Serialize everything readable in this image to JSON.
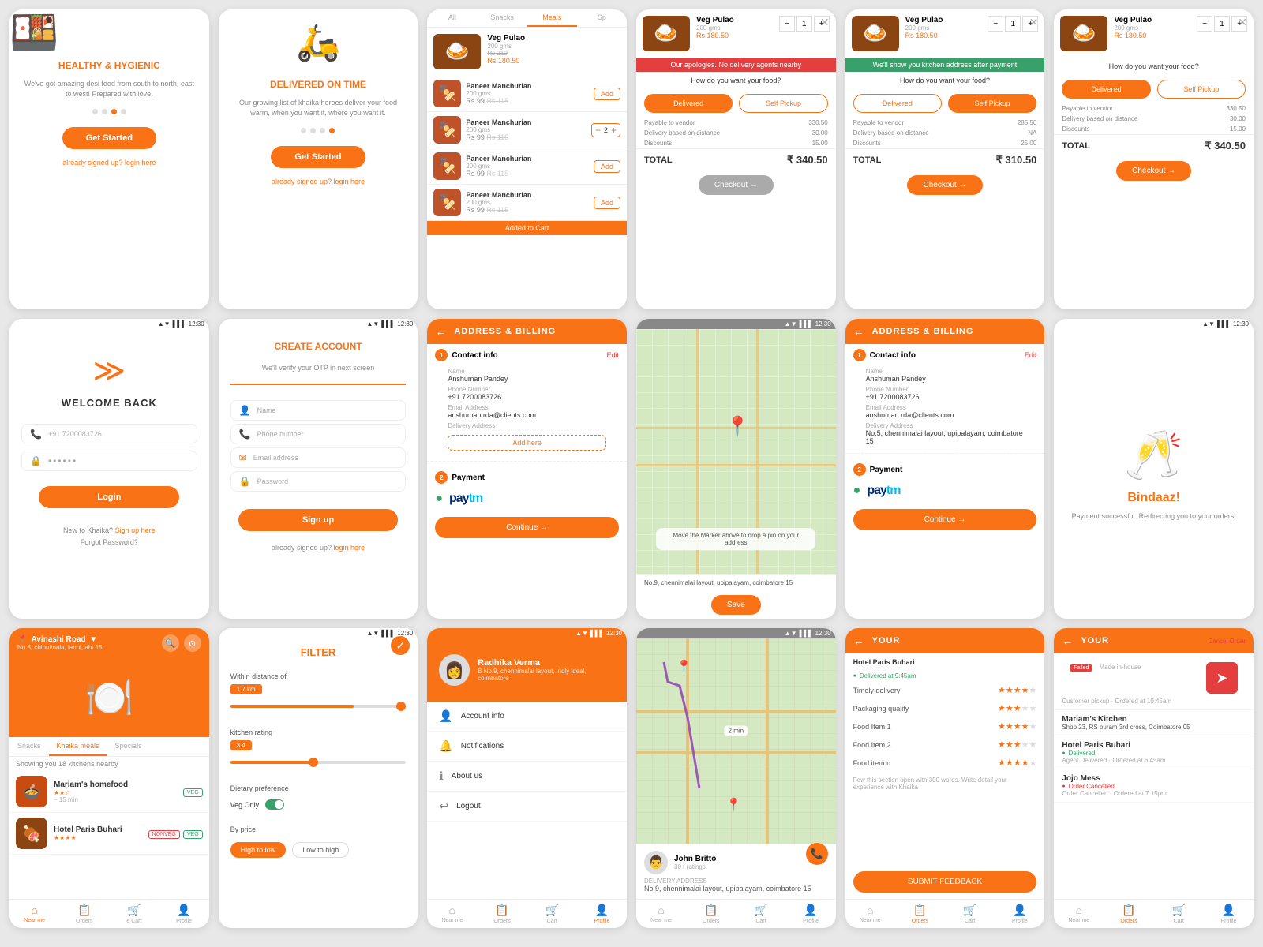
{
  "row1": {
    "card1": {
      "title": "HEALTHY & HYGIENIC",
      "desc": "We've got amazing desi food from south to north, east to west! Prepared with love.",
      "cta": "Get Started",
      "footer": "already signed up?",
      "login": "login here",
      "dots": [
        false,
        false,
        true,
        false
      ]
    },
    "card2": {
      "title": "DELIVERED ON TIME",
      "desc": "Our growing list of khaika heroes deliver your food warm, when you want it, where you want it.",
      "cta": "Get Started",
      "footer": "already signed up?",
      "login": "login here",
      "dots": [
        false,
        false,
        false,
        true
      ]
    },
    "card3": {
      "tabs": [
        "All",
        "Snacks",
        "Meals",
        "Sp"
      ],
      "active_tab": 2,
      "food_name": "Veg Pulao",
      "food_qty": "200 gms",
      "food_price_old": "Rs 210",
      "food_price_new": "Rs 180.50",
      "items": [
        {
          "name": "Paneer Manchurian",
          "qty": "200 gms",
          "price_old": "Rs 115",
          "price_new": "Rs 99",
          "action": "add"
        },
        {
          "name": "Paneer Manchurian",
          "qty": "200 gms",
          "price_old": "Rs 115",
          "price_new": "Rs 99",
          "action": "qty",
          "qty_val": "2"
        },
        {
          "name": "Paneer Manchurian",
          "qty": "200 gms",
          "price_old": "Rs 115",
          "price_new": "Rs 99",
          "action": "add"
        },
        {
          "name": "Paneer Manchurian",
          "qty": "200 gms",
          "price_old": "Rs 115",
          "price_new": "Rs 99",
          "action": "add"
        }
      ],
      "added_banner": "Added to Cart"
    },
    "card4": {
      "food_name": "Veg Pulao",
      "food_qty": "200 gms",
      "food_price_new": "Rs 180.50",
      "sorry_banner": "Our apologies. No delivery agents nearby",
      "how_food": "How do you want your food?",
      "delivered": "Delivered",
      "self_pickup": "Self Pickup",
      "details": [
        {
          "label": "Payable to vendor",
          "val": "330.50"
        },
        {
          "label": "Delivery based on distance",
          "val": "30.00"
        },
        {
          "label": "Discounts",
          "val": "15.00"
        }
      ],
      "total_label": "TOTAL",
      "total_amount": "₹ 340.50",
      "checkout": "Checkout →"
    },
    "card5": {
      "food_name": "Veg Pulao",
      "food_qty": "200 gms",
      "food_price_new": "Rs 180.50",
      "success_banner": "We'll show you kitchen address after payment",
      "how_food": "How do you want your food?",
      "delivered": "Delivered",
      "self_pickup": "Self Pickup",
      "details": [
        {
          "label": "Payable to vendor",
          "val": "285.50"
        },
        {
          "label": "Delivery based on distance",
          "val": "NA"
        },
        {
          "label": "Discounts",
          "val": "25.00"
        }
      ],
      "total_label": "TOTAL",
      "total_amount": "₹ 310.50",
      "checkout": "Checkout →"
    },
    "card6": {
      "food_name": "Veg Pulao",
      "food_qty": "200 gms",
      "food_price_new": "Rs 180.50",
      "how_food": "How do you want your food?",
      "delivered": "Delivered",
      "self_pickup": "Self Pickup",
      "details": [
        {
          "label": "Payable to vendor",
          "val": "330.50"
        },
        {
          "label": "Delivery based on distance",
          "val": "30.00"
        },
        {
          "label": "Discounts",
          "val": "15.00"
        }
      ],
      "total_label": "TOTAL",
      "total_amount": "₹ 340.50",
      "checkout": "Checkout →"
    }
  },
  "row2": {
    "card1": {
      "logo": "≫",
      "title": "WELCOME BACK",
      "phone_placeholder": "+91 7200083726",
      "password_placeholder": "••••••",
      "login_btn": "Login",
      "new_user": "New to Khaika?",
      "signup_link": "Sign up here",
      "forgot": "Forgot Password?"
    },
    "card2": {
      "title": "CREATE ACCOUNT",
      "subtitle": "We'll verify your OTP in next screen",
      "name_placeholder": "Name",
      "phone_placeholder": "Phone number",
      "email_placeholder": "Email address",
      "password_placeholder": "Password",
      "signup_btn": "Sign up",
      "already": "already signed up?",
      "login_link": "login here"
    },
    "card3": {
      "header": "ADDRESS & BILLING",
      "step1": "1",
      "contact_title": "Contact info",
      "edit": "Edit",
      "name_label": "Name",
      "name_val": "Anshuman Pandey",
      "phone_label": "Phone Number",
      "phone_val": "+91 7200083726",
      "email_label": "Email Address",
      "email_val": "anshuman.rda@clients.com",
      "delivery_label": "Delivery Address",
      "add_here": "Add here",
      "step2": "2",
      "payment_title": "Payment",
      "payment_brand": "paytm",
      "continue": "Continue →"
    },
    "card4": {
      "map_instruction": "Move the Marker above to drop a pin on your address",
      "address": "No.9, chennimalai layout, upipalayam, coimbatore 15",
      "save_btn": "Save"
    },
    "card5": {
      "header": "ADDRESS & BILLING",
      "step1": "1",
      "contact_title": "Contact info",
      "edit": "Edit",
      "name_label": "Name",
      "name_val": "Anshuman Pandey",
      "phone_label": "Phone Number",
      "phone_val": "+91 7200083726",
      "email_label": "Email Address",
      "email_val": "anshuman.rda@clients.com",
      "delivery_label": "Delivery Address",
      "delivery_val": "No.5, chennimalai layout, upipalayam, coimbatore 15",
      "step2": "2",
      "payment_title": "Payment",
      "payment_brand": "paytm",
      "continue": "Continue →"
    },
    "card6": {
      "title": "Bindaaz!",
      "desc": "Payment successful. Redirecting you to your orders."
    }
  },
  "row3": {
    "card1": {
      "location": "Avinashi Road",
      "sub_location": "No.8, chinnimala, lanoi, abt 15",
      "tabs": [
        "Snacks",
        "Khaika meals",
        "Specials"
      ],
      "active_tab": 1,
      "nearby_text": "Showing you 18 kitchens nearby",
      "kitchen1_name": "Mariam's homefood",
      "kitchen1_time": "~ 15 min",
      "kitchen1_stars": "★★☆",
      "kitchen2_name": "Hotel Paris Buhari",
      "kitchen2_stars": "★★★★"
    },
    "card2": {
      "filter_title": "FILTER",
      "distance_label": "Within distance of",
      "distance_val": "1.7 km",
      "rating_label": "kitchen rating",
      "rating_val": "3.4",
      "dietary_label": "Dietary preference",
      "dietary_val": "Veg Only",
      "price_label": "By price",
      "price_options": [
        "High to low",
        "Low to high"
      ],
      "price_active": 0
    },
    "card3": {
      "name": "Radhika Verma",
      "address": "B No.9, chennimalai layout, lndly ideal, coimbatore",
      "menu_items": [
        "Account info",
        "Notifications",
        "About us",
        "Logout"
      ]
    },
    "card4": {
      "driver_name": "John Britto",
      "driver_ratings": "30+ ratings",
      "delivery_address": "No.9, chennimalai layout, upipalayam, coimbatore 15"
    },
    "card5": {
      "header": "YOUR",
      "back": "←",
      "restaurant": "Hotel Paris Buhari",
      "order_status1": "Delivered at 9:45am",
      "ratings": [
        {
          "label": "Timely delivery",
          "stars": 4
        },
        {
          "label": "Packaging quality",
          "stars": 3
        },
        {
          "label": "Food Item 1",
          "stars": 4
        },
        {
          "label": "Food Item 2",
          "stars": 3
        },
        {
          "label": "Food item n",
          "stars": 4
        }
      ],
      "feedback_desc": "Few this section open with 300 words. Write detail your experience with Khaika",
      "submit_btn": "SUBMIT FEEDBACK"
    },
    "card6": {
      "header": "YOUR",
      "cancel_order": "Cancel Order",
      "orders": [
        {
          "status": "Failed",
          "detail": "Made in-house",
          "time": "Customer pickup · Ordered at 10:45am"
        },
        {
          "name": "Mariam's Kitchen",
          "address": "Shop 23, RS puram 3rd cross, Coimbatore 05"
        },
        {
          "name": "Hotel Paris Buhari",
          "status": "Delivered",
          "time": "Agent Delivered · Ordered at 6:45am"
        },
        {
          "name": "Jojo Mess",
          "status": "Order Cancelled",
          "time": "Order Cancelled · Ordered at 7:15pm"
        }
      ],
      "nav": [
        "Near me",
        "Orders",
        "Cart",
        "Profile"
      ]
    }
  },
  "status_bar": {
    "time": "12:30",
    "wifi": "▲▼",
    "signal": "▌▌▌"
  }
}
